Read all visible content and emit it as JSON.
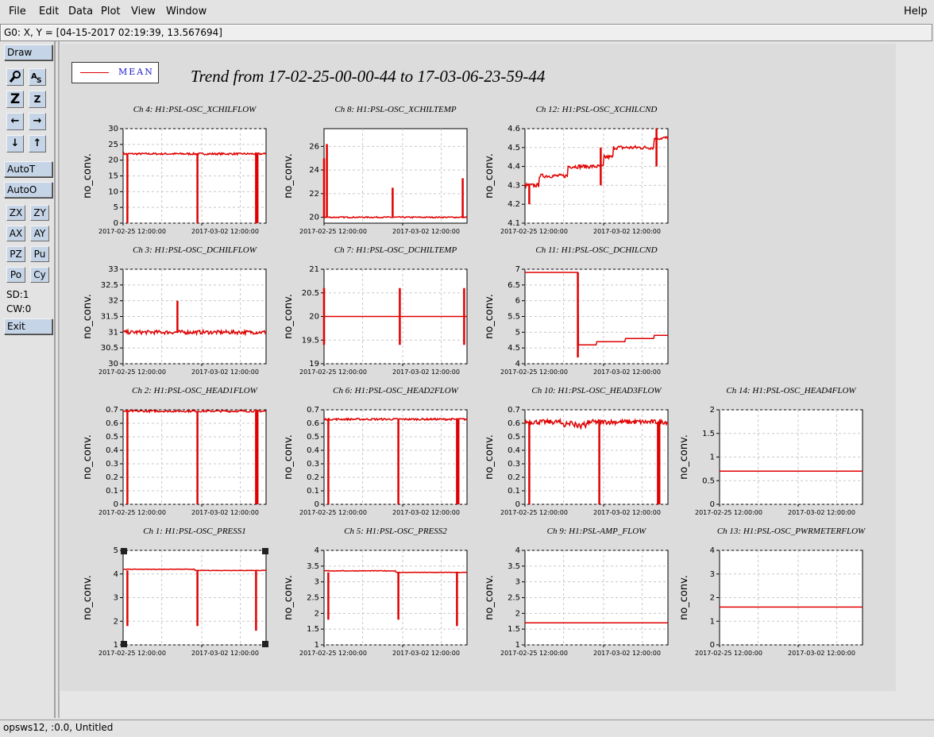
{
  "menu": {
    "file": "File",
    "edit": "Edit",
    "data": "Data",
    "plot": "Plot",
    "view": "View",
    "window": "Window",
    "help": "Help"
  },
  "coord_readout": "G0: X, Y = [04-15-2017 02:19:39, 13.567694]",
  "toolbox": {
    "draw": "Draw",
    "autot": "AutoT",
    "autoo": "AutoO",
    "zx": "ZX",
    "zy": "ZY",
    "ax": "AX",
    "ay": "AY",
    "pz": "PZ",
    "pu": "Pu",
    "po": "Po",
    "cy": "Cy",
    "sd": "SD:1",
    "cw": "CW:0",
    "exit": "Exit",
    "icons": [
      "magnifier-icon",
      "text-icon",
      "zoom-large-icon",
      "zoom-small-icon",
      "arrow-left-icon",
      "arrow-right-icon",
      "arrow-down-icon",
      "arrow-up-icon"
    ]
  },
  "legend": {
    "label": "MEAN",
    "color": "#e00000"
  },
  "plot_title": "Trend from 17-02-25-00-00-44 to 17-03-06-23-59-44",
  "status": "opsws12, :0.0, Untitled",
  "series_color": "#e00000",
  "ylabel": "no_conv.",
  "xticks": [
    "2017-02-25 12:00:00",
    "2017-03-02 12:00:00"
  ],
  "chart_data": [
    {
      "type": "line",
      "title": "Ch 4: H1:PSL-OSC_XCHILFLOW",
      "ylabel": "no_conv.",
      "ylim": [
        0,
        30
      ],
      "yticks": [
        0,
        5,
        10,
        15,
        20,
        25,
        30
      ],
      "pattern": "flow",
      "base": 22.0,
      "drop": 0,
      "xticks": [
        "2017-02-25 12:00:00",
        "2017-03-02 12:00:00"
      ]
    },
    {
      "type": "line",
      "title": "Ch 8: H1:PSL-OSC_XCHILTEMP",
      "ylabel": "no_conv.",
      "ylim": [
        19.5,
        27.5
      ],
      "yticks": [
        20,
        22,
        24,
        26
      ],
      "pattern": "temp",
      "base": 20.0,
      "xticks": [
        "2017-02-25 12:00:00",
        "2017-03-02 12:00:00"
      ]
    },
    {
      "type": "line",
      "title": "Ch 12: H1:PSL-OSC_XCHILCND",
      "ylabel": "no_conv.",
      "ylim": [
        4.1,
        4.6
      ],
      "yticks": [
        4.1,
        4.2,
        4.3,
        4.4,
        4.5,
        4.6
      ],
      "pattern": "cnd_x",
      "xticks": [
        "2017-02-25 12:00:00",
        "2017-03-02 12:00:00"
      ]
    },
    {
      "type": "line",
      "title": "Ch 3: H1:PSL-OSC_DCHILFLOW",
      "ylabel": "no_conv.",
      "ylim": [
        30,
        33
      ],
      "yticks": [
        30,
        30.5,
        31,
        31.5,
        32,
        32.5,
        33
      ],
      "pattern": "dflow",
      "base": 31.0,
      "xticks": [
        "2017-02-25 12:00:00",
        "2017-03-02 12:00:00"
      ]
    },
    {
      "type": "line",
      "title": "Ch 7: H1:PSL-OSC_DCHILTEMP",
      "ylabel": "no_conv.",
      "ylim": [
        19,
        21
      ],
      "yticks": [
        19,
        19.5,
        20,
        20.5,
        21
      ],
      "pattern": "dtemp",
      "base": 20.0,
      "xticks": [
        "2017-02-25 12:00:00",
        "2017-03-02 12:00:00"
      ]
    },
    {
      "type": "line",
      "title": "Ch 11: H1:PSL-OSC_DCHILCND",
      "ylabel": "no_conv.",
      "ylim": [
        4,
        7
      ],
      "yticks": [
        4,
        4.5,
        5,
        5.5,
        6,
        6.5,
        7
      ],
      "pattern": "cnd_d",
      "xticks": [
        "2017-02-25 12:00:00",
        "2017-03-02 12:00:00"
      ]
    },
    {
      "type": "line",
      "title": "Ch 2: H1:PSL-OSC_HEAD1FLOW",
      "ylabel": "no_conv.",
      "ylim": [
        0,
        0.7
      ],
      "yticks": [
        0,
        0.1,
        0.2,
        0.3,
        0.4,
        0.5,
        0.6,
        0.7
      ],
      "pattern": "flow",
      "base": 0.69,
      "xticks": [
        "2017-02-25 12:00:00",
        "2017-03-02 12:00:00"
      ]
    },
    {
      "type": "line",
      "title": "Ch 6: H1:PSL-OSC_HEAD2FLOW",
      "ylabel": "no_conv.",
      "ylim": [
        0,
        0.7
      ],
      "yticks": [
        0,
        0.1,
        0.2,
        0.3,
        0.4,
        0.5,
        0.6,
        0.7
      ],
      "pattern": "flow",
      "base": 0.63,
      "xticks": [
        "2017-02-25 12:00:00",
        "2017-03-02 12:00:00"
      ]
    },
    {
      "type": "line",
      "title": "Ch 10: H1:PSL-OSC_HEAD3FLOW",
      "ylabel": "no_conv.",
      "ylim": [
        0,
        0.7
      ],
      "yticks": [
        0,
        0.1,
        0.2,
        0.3,
        0.4,
        0.5,
        0.6,
        0.7
      ],
      "pattern": "flow3",
      "base": 0.61,
      "xticks": [
        "2017-02-25 12:00:00",
        "2017-03-02 12:00:00"
      ]
    },
    {
      "type": "line",
      "title": "Ch 14: H1:PSL-OSC_HEAD4FLOW",
      "ylabel": "no_conv.",
      "ylim": [
        0,
        2
      ],
      "yticks": [
        0,
        0.5,
        1,
        1.5,
        2
      ],
      "pattern": "flat",
      "base": 0.7,
      "xticks": [
        "2017-02-25 12:00:00",
        "2017-03-02 12:00:00"
      ]
    },
    {
      "type": "line",
      "title": "Ch 1: H1:PSL-OSC_PRESS1",
      "ylabel": "no_conv.",
      "ylim": [
        1,
        5
      ],
      "yticks": [
        1,
        2,
        3,
        4,
        5
      ],
      "pattern": "press",
      "base": 4.15,
      "selected": true,
      "xticks": [
        "2017-02-25 12:00:00",
        "2017-03-02 12:00:00"
      ]
    },
    {
      "type": "line",
      "title": "Ch 5: H1:PSL-OSC_PRESS2",
      "ylabel": "no_conv.",
      "ylim": [
        1,
        4
      ],
      "yticks": [
        1,
        1.5,
        2,
        2.5,
        3,
        3.5,
        4
      ],
      "pattern": "press",
      "base": 3.3,
      "xticks": [
        "2017-02-25 12:00:00",
        "2017-03-02 12:00:00"
      ]
    },
    {
      "type": "line",
      "title": "Ch 9: H1:PSL-AMP_FLOW",
      "ylabel": "no_conv.",
      "ylim": [
        1,
        4
      ],
      "yticks": [
        1,
        1.5,
        2,
        2.5,
        3,
        3.5,
        4
      ],
      "pattern": "flat",
      "base": 1.7,
      "xticks": [
        "2017-02-25 12:00:00",
        "2017-03-02 12:00:00"
      ]
    },
    {
      "type": "line",
      "title": "Ch 13: H1:PSL-OSC_PWRMETERFLOW",
      "ylabel": "no_conv.",
      "ylim": [
        0,
        4
      ],
      "yticks": [
        0,
        1,
        2,
        3,
        4
      ],
      "pattern": "flat",
      "base": 1.6,
      "xticks": [
        "2017-02-25 12:00:00",
        "2017-03-02 12:00:00"
      ]
    }
  ]
}
